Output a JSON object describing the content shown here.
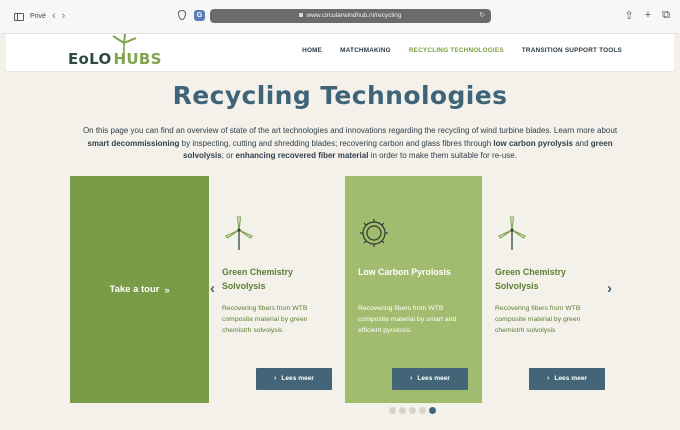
{
  "browser": {
    "tab_label": "Privé",
    "url": "www.circularwindhub.nl/recycling",
    "back_icon": "chevron-left",
    "forward_icon": "chevron-right",
    "share_icon": "share",
    "new_tab_icon": "plus",
    "tabs_icon": "tabs"
  },
  "header": {
    "logo_part1": "EoLO",
    "logo_part2": "HUBS",
    "nav": [
      {
        "label": "HOME",
        "active": false
      },
      {
        "label": "MATCHMAKING",
        "active": false
      },
      {
        "label": "RECYCLING TECHNOLOGIES",
        "active": true
      },
      {
        "label": "TRANSITION SUPPORT TOOLS",
        "active": false
      }
    ]
  },
  "main": {
    "title": "Recycling Technologies",
    "intro": {
      "t1": "On this page you can find an overview of state of the art technologies and innovations regarding the recycling of wind turbine blades. Learn more about ",
      "b1": "smart decommissioning",
      "t2": " by inspecting, cutting and shredding blades; recovering carbon and glass fibres through ",
      "b2": "low carbon pyrolysis",
      "t3": " and ",
      "b3": "green solvolysis",
      "t4": "; or ",
      "b4": "enhancing recovered fiber material",
      "t5": " in order to make them suitable for re-use."
    }
  },
  "carousel": {
    "tour_label": "Take a tour",
    "tour_chevron": "»",
    "prev": "‹",
    "next": "›",
    "cards": [
      {
        "title": "Green Chemistry Solvolysis",
        "desc": "Recovering fibers from WTB composite material by green chemistrh solvolysis",
        "button": "Lees meer",
        "icon": "wind-turbine-icon"
      },
      {
        "title": "Low Carbon Pyrolosis",
        "desc": "Recovering fibers from WTB composite material by smart and efficient pyrolosis.",
        "button": "Lees meer",
        "icon": "gear-icon"
      },
      {
        "title": "Green Chemistry Solvolysis",
        "desc": "Recovering fibers from WTB composite material by green chemistrh solvolysis",
        "button": "Lees meer",
        "icon": "wind-turbine-icon"
      }
    ],
    "dots_count": 5,
    "active_dot": 4
  },
  "colors": {
    "accent_green": "#7a9b48",
    "light_green": "#a1bc6f",
    "title_blue": "#3f6478",
    "button_blue": "#426677"
  }
}
